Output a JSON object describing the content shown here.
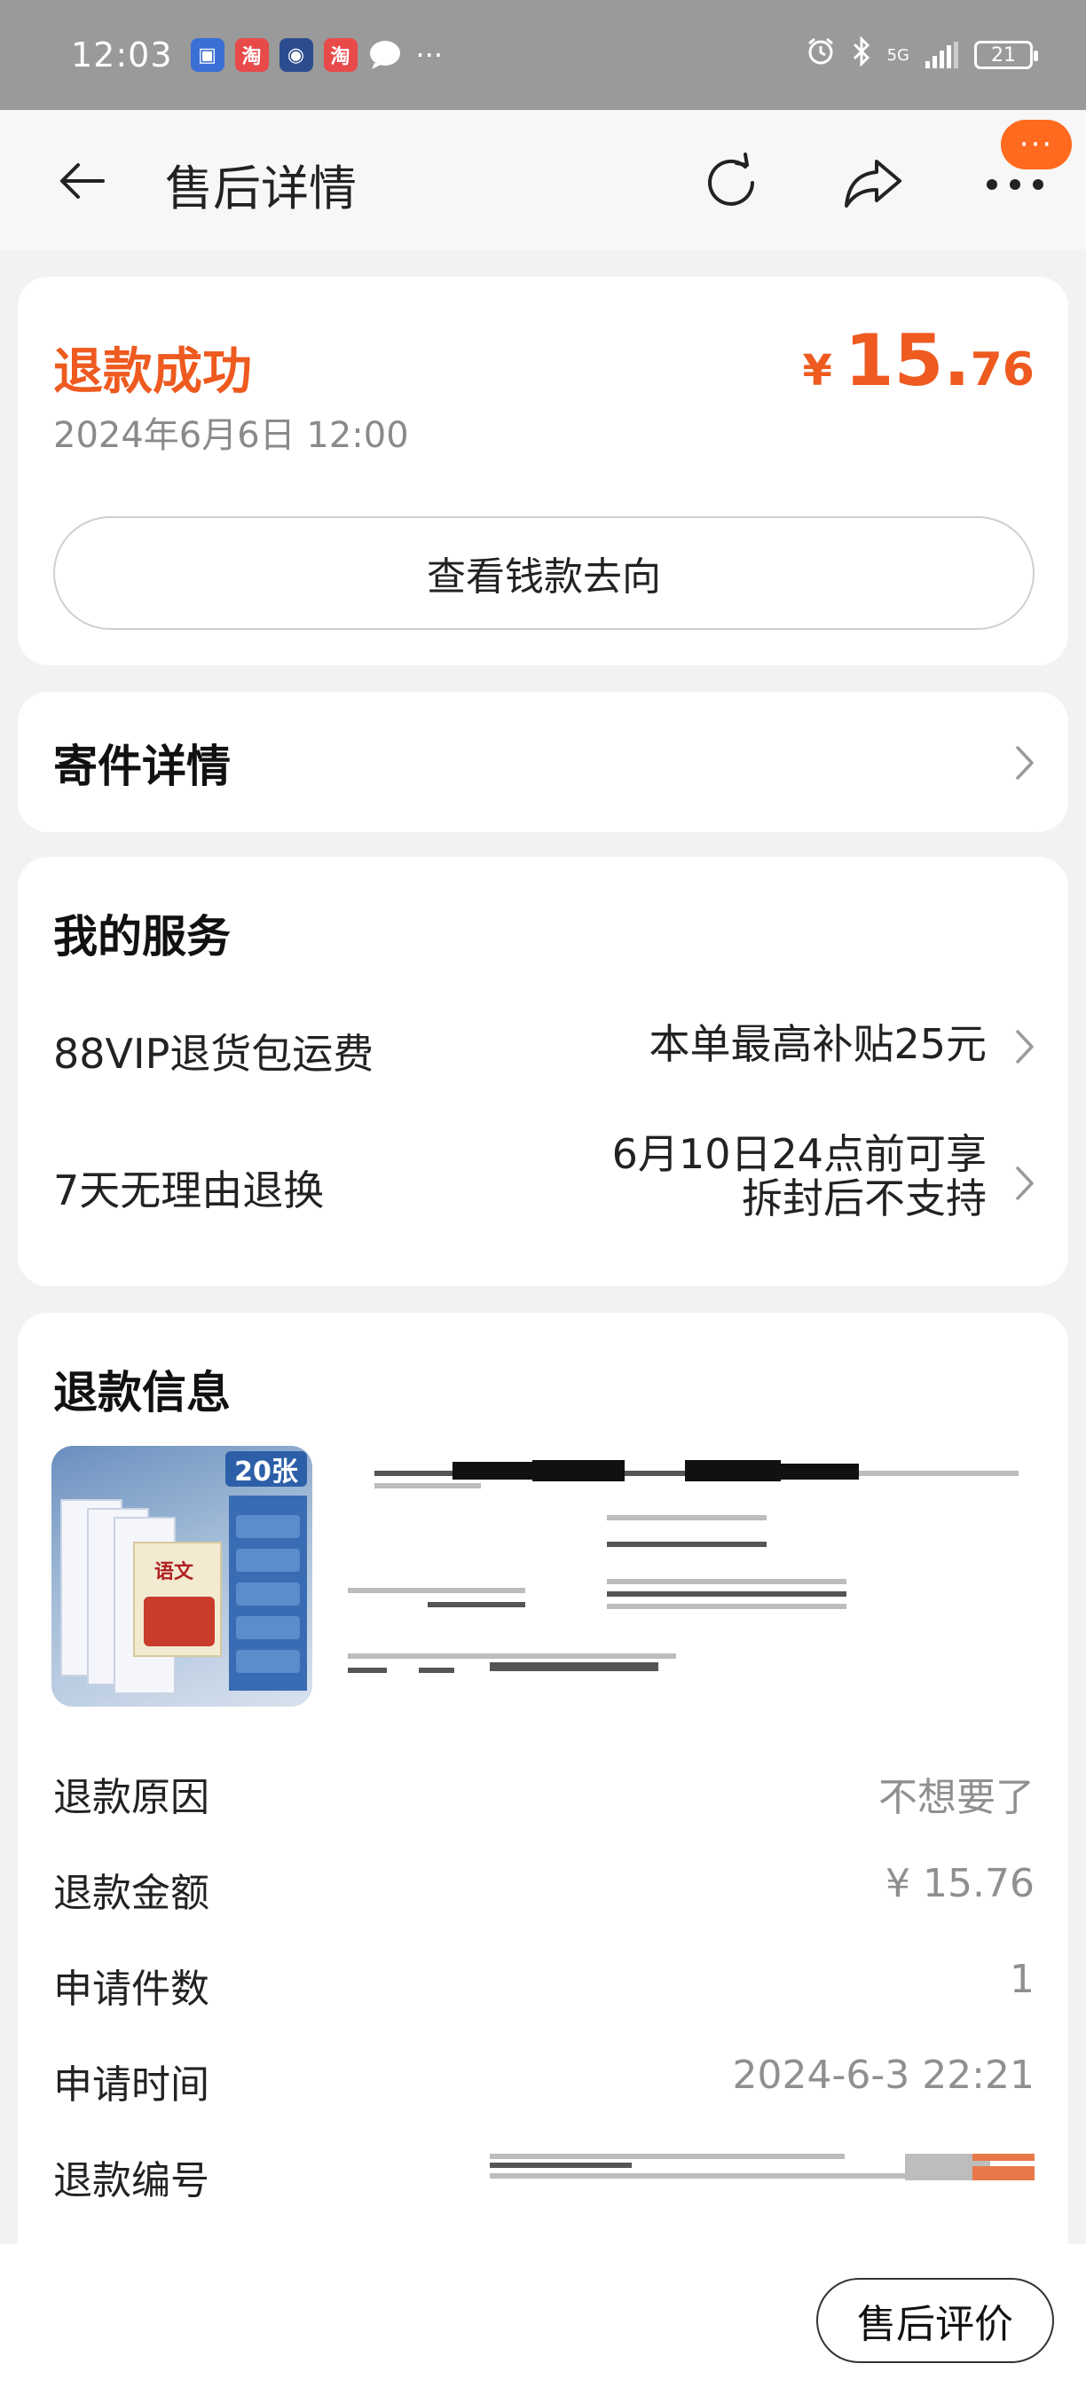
{
  "status_bar": {
    "time": "12:03",
    "battery": "21",
    "network": "5G"
  },
  "nav": {
    "title": "售后详情",
    "more_badge": "···"
  },
  "refund": {
    "status": "退款成功",
    "date": "2024年6月6日 12:00",
    "currency": "¥",
    "amount_int": "15.",
    "amount_dec": "76",
    "money_button": "查看钱款去向"
  },
  "shipping": {
    "title": "寄件详情"
  },
  "service": {
    "title": "我的服务",
    "items": [
      {
        "label": "88VIP退货包运费",
        "value_line1": "本单最高补贴25元",
        "value_line2": ""
      },
      {
        "label": "7天无理由退换",
        "value_line1": "6月10日24点前可享",
        "value_line2": "拆封后不支持"
      }
    ]
  },
  "refund_info": {
    "title": "退款信息",
    "product_tag": "20张",
    "product_book": "语文",
    "rows": [
      {
        "label": "退款原因",
        "value": "不想要了"
      },
      {
        "label": "退款金额",
        "value": "¥ 15.76"
      },
      {
        "label": "申请件数",
        "value": "1"
      },
      {
        "label": "申请时间",
        "value": "2024-6-3 22:21"
      },
      {
        "label": "退款编号",
        "value": ""
      }
    ]
  },
  "bottom": {
    "review_button": "售后评价"
  },
  "colors": {
    "accent": "#ee5a1f",
    "badge": "#ff6a1e",
    "muted": "#8f8f8f"
  }
}
